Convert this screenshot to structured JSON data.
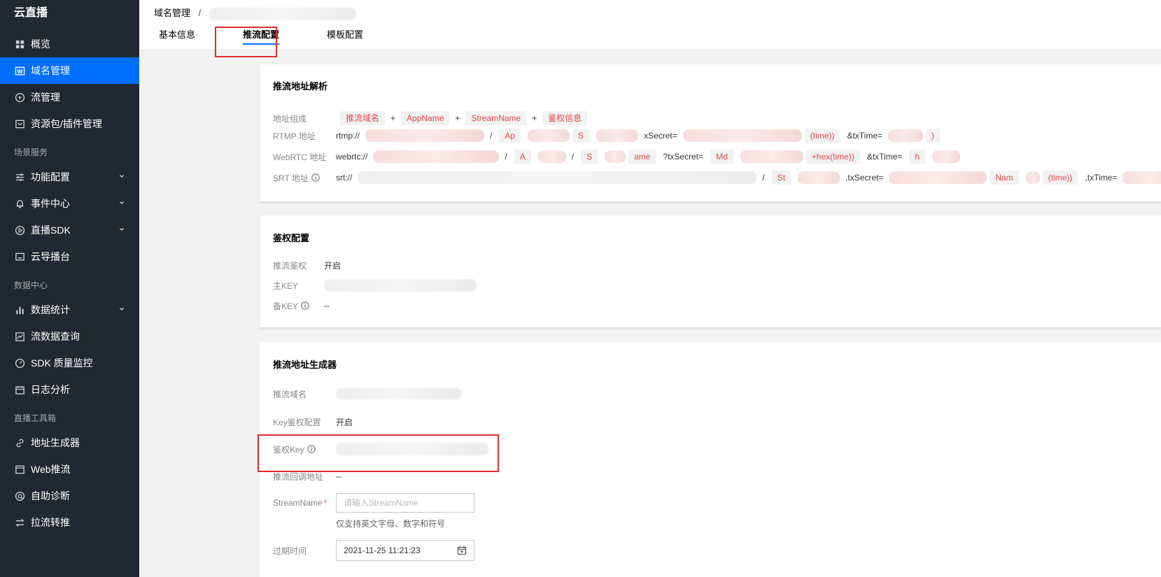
{
  "sidebar": {
    "brand": "云直播",
    "items_top": [
      {
        "label": "概览",
        "icon": "grid-icon",
        "active": false
      },
      {
        "label": "域名管理",
        "icon": "domain-icon",
        "active": true
      },
      {
        "label": "流管理",
        "icon": "play-circle-icon",
        "active": false
      },
      {
        "label": "资源包/插件管理",
        "icon": "package-icon",
        "active": false
      }
    ],
    "section_scene": "场景服务",
    "items_scene": [
      {
        "label": "功能配置",
        "icon": "sliders-icon",
        "expandable": true
      },
      {
        "label": "事件中心",
        "icon": "bell-icon",
        "expandable": true
      },
      {
        "label": "直播SDK",
        "icon": "play-icon",
        "expandable": true
      },
      {
        "label": "云导播台",
        "icon": "monitor-icon",
        "expandable": false
      }
    ],
    "section_data": "数据中心",
    "items_data": [
      {
        "label": "数据统计",
        "icon": "bar-chart-icon",
        "expandable": true
      },
      {
        "label": "流数据查询",
        "icon": "line-chart-icon",
        "expandable": false
      },
      {
        "label": "SDK 质量监控",
        "icon": "gauge-icon",
        "expandable": false
      },
      {
        "label": "日志分析",
        "icon": "calendar-icon",
        "expandable": false
      }
    ],
    "section_tools": "直播工具箱",
    "items_tools": [
      {
        "label": "地址生成器",
        "icon": "link-icon",
        "expandable": false
      },
      {
        "label": "Web推流",
        "icon": "window-icon",
        "expandable": false
      },
      {
        "label": "自助诊断",
        "icon": "diagnose-icon",
        "expandable": false
      },
      {
        "label": "拉流转推",
        "icon": "swap-icon",
        "expandable": false
      }
    ]
  },
  "header": {
    "breadcrumb_root": "域名管理",
    "breadcrumb_sep": "/",
    "tabs": [
      "基本信息",
      "推流配置",
      "模板配置"
    ],
    "active_tab": 1
  },
  "card_parse": {
    "title": "推流地址解析",
    "compose_label": "地址组成",
    "compose_parts": [
      "推流域名",
      "AppName",
      "StreamName",
      "鉴权信息"
    ],
    "plus": "+",
    "rtmp_label": "RTMP 地址",
    "rtmp_prefix": "rtmp://",
    "rtmp_frag_app": "Ap",
    "rtmp_frag_stream": "S",
    "rtmp_frag_secret": "xSecret=",
    "rtmp_frag_time": "(time))",
    "rtmp_frag_txtime": "&txTime=",
    "rtmp_frag_end": ")",
    "webrtc_label": "WebRTC 地址",
    "webrtc_prefix": "webrtc://",
    "webrtc_frag_a": "A",
    "webrtc_frag_s": "S",
    "webrtc_frag_name": "ame",
    "webrtc_frag_secret": "?txSecret=",
    "webrtc_frag_md": "Md",
    "webrtc_frag_hex": "+hex(time))",
    "webrtc_frag_txtime": "&txTime=",
    "webrtc_frag_h": "h",
    "srt_label": "SRT 地址",
    "srt_prefix": "srt://",
    "srt_frag_st": "St",
    "srt_frag_secret": ",txSecret=",
    "srt_frag_nam": "Nam",
    "srt_frag_time": "(time))",
    "srt_frag_txtime": ",txTime=",
    "slash": "/"
  },
  "card_auth": {
    "title": "鉴权配置",
    "push_auth_label": "推流鉴权",
    "push_auth_value": "开启",
    "main_key_label": "主KEY",
    "backup_key_label": "备KEY",
    "backup_key_value": "--"
  },
  "card_gen": {
    "title": "推流地址生成器",
    "domain_label": "推流域名",
    "key_auth_label": "Key鉴权配置",
    "key_auth_value": "开启",
    "auth_key_label": "鉴权Key",
    "callback_label": "推流回调地址",
    "callback_value": "--",
    "stream_label": "StreamName",
    "required_mark": "*",
    "stream_placeholder": "请输入StreamName",
    "stream_hint": "仅支持英文字母、数字和符号",
    "expire_label": "过期时间",
    "expire_value": "2021-11-25 11:21:23"
  },
  "colors": {
    "sidebar_bg": "#222831",
    "active_blue": "#006eff",
    "highlight_red": "#e12b2b",
    "tag_text": "#e54545"
  }
}
